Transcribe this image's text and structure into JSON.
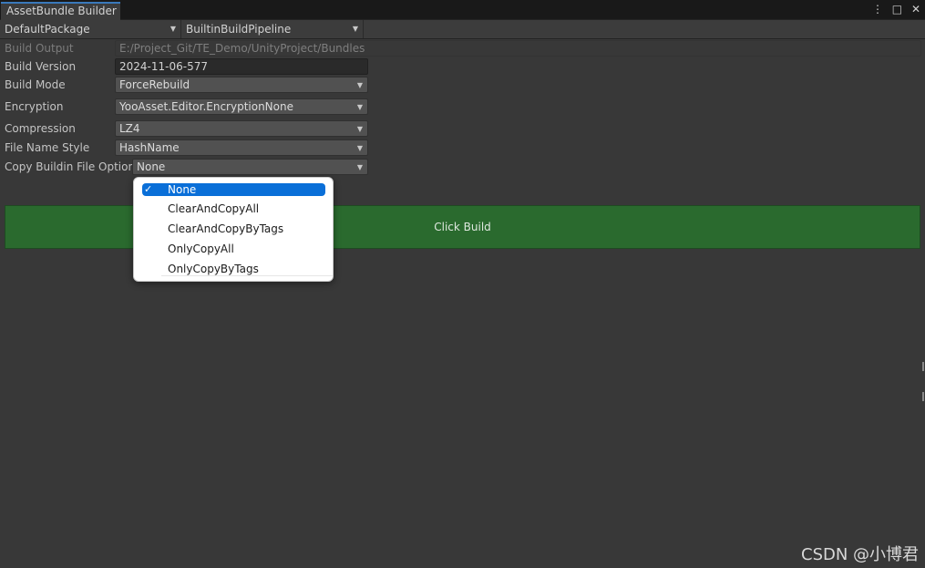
{
  "window": {
    "tab_title": "AssetBundle Builder",
    "icons": [
      "kebab-menu-icon",
      "maximize-icon",
      "close-icon"
    ]
  },
  "toolbar": {
    "package": "DefaultPackage",
    "pipeline": "BuiltinBuildPipeline"
  },
  "fields": {
    "build_output": {
      "label": "Build Output",
      "value": "E:/Project_Git/TE_Demo/UnityProject/Bundles"
    },
    "build_version": {
      "label": "Build Version",
      "value": "2024-11-06-577"
    },
    "build_mode": {
      "label": "Build Mode",
      "value": "ForceRebuild"
    },
    "encryption": {
      "label": "Encryption",
      "value": "YooAsset.Editor.EncryptionNone"
    },
    "compression": {
      "label": "Compression",
      "value": "LZ4"
    },
    "file_name_style": {
      "label": "File Name Style",
      "value": "HashName"
    },
    "copy_buildin": {
      "label": "Copy Buildin File Option",
      "value": "None"
    }
  },
  "build_button": {
    "label": "Click Build",
    "color": "#2a6a2e"
  },
  "dropdown": {
    "options": [
      "None",
      "ClearAndCopyAll",
      "ClearAndCopyByTags",
      "OnlyCopyAll",
      "OnlyCopyByTags"
    ],
    "selected": "None",
    "selected_color": "#0a6fd8"
  },
  "watermark": "CSDN @小博君"
}
